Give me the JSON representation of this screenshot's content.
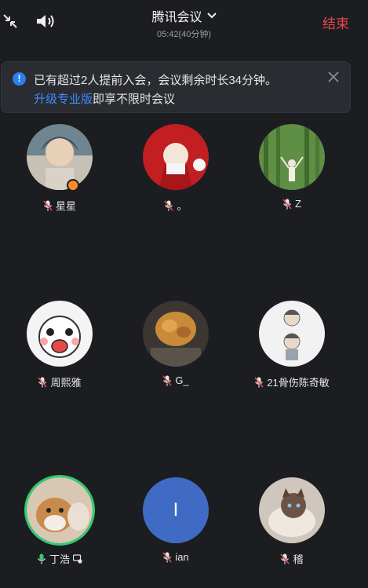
{
  "topbar": {
    "title": "腾讯会议",
    "duration": "05:42(40分钟)",
    "end_label": "结束"
  },
  "notice": {
    "line1": "已有超过2人提前入会，会议剩余时长34分钟。",
    "link": "升级专业版",
    "line2_rest": "即享不限时会议"
  },
  "participants": [
    {
      "name": "星星",
      "mic": "muted",
      "host": true,
      "avatar_color": "#5a6a72"
    },
    {
      "name": "。",
      "mic": "muted",
      "avatar_color": "#c21f23"
    },
    {
      "name": "Z",
      "mic": "muted",
      "avatar_color": "#4f7d3a"
    },
    {
      "name": "周熙雅",
      "mic": "muted",
      "avatar_color": "#f4f4f4"
    },
    {
      "name": "G_",
      "mic": "muted",
      "avatar_color": "#3b3631"
    },
    {
      "name": "21骨伤陈奇敏",
      "mic": "muted",
      "avatar_color": "#f2f2f2"
    },
    {
      "name": "丁浩",
      "mic": "active",
      "speaking": true,
      "avatar_color": "#b08a6a"
    },
    {
      "name": "ian",
      "mic": "muted",
      "avatar_letter": "I",
      "avatar_color": "#3f6bc4"
    },
    {
      "name": "稽",
      "mic": "muted",
      "avatar_color": "#cfc6bd"
    }
  ],
  "colors": {
    "background": "#1c1d21",
    "end": "#e5484d",
    "link": "#3d8dff",
    "speaking": "#2ecc71",
    "muted_mic": "#e5484d",
    "active_mic": "#2ecc71"
  }
}
